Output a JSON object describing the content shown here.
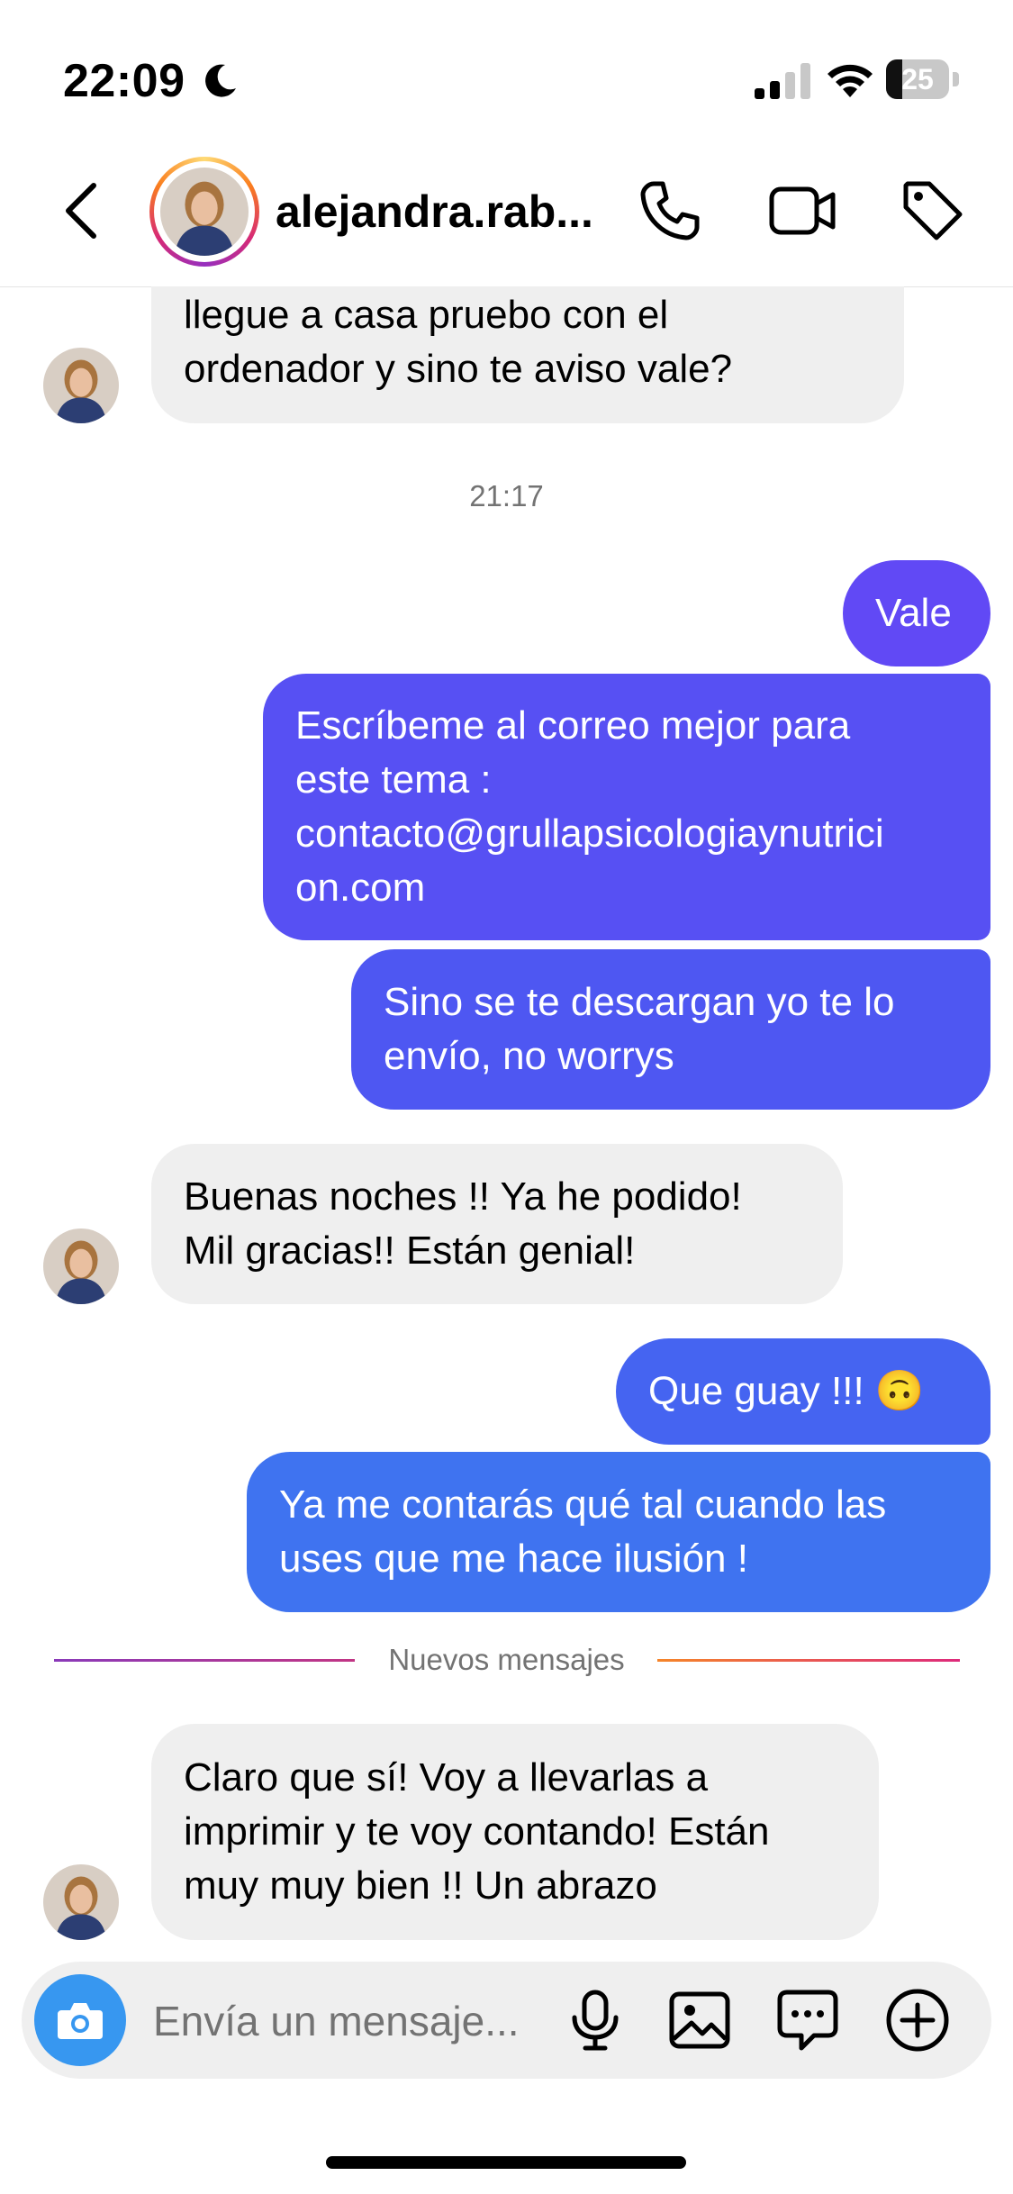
{
  "status_bar": {
    "time": "22:09",
    "battery_percent": "25",
    "battery_level": 0.25
  },
  "header": {
    "username": "alejandra.rab...",
    "icons": [
      "chevron-left-icon",
      "phone-icon",
      "video-camera-icon",
      "tag-icon"
    ]
  },
  "colors": {
    "outgoing_purple": "#6149f5",
    "outgoing_indigo": "#5253f2",
    "outgoing_blue": "#3f73f0",
    "incoming_bg": "#efefef",
    "camera_blue": "#3797f0"
  },
  "messages": [
    {
      "id": "m1",
      "direction": "in",
      "lines": [
        "llegue a casa pruebo con el",
        "ordenador y sino te aviso vale?"
      ]
    },
    {
      "id": "m2",
      "direction": "out",
      "lines": [
        "Vale"
      ]
    },
    {
      "id": "m3",
      "direction": "out",
      "lines": [
        "Escríbeme al correo mejor para",
        "este tema :",
        "contacto@grullapsicologiaynutrici",
        "on.com"
      ]
    },
    {
      "id": "m4",
      "direction": "out",
      "lines": [
        "Sino se te descargan yo te lo",
        "envío, no worrys"
      ]
    },
    {
      "id": "m5",
      "direction": "in",
      "lines": [
        "Buenas noches !! Ya he podido!",
        "Mil gracias!! Están genial!"
      ]
    },
    {
      "id": "m6",
      "direction": "out",
      "lines": [
        "Que guay !!! 🙃"
      ]
    },
    {
      "id": "m7",
      "direction": "out",
      "lines": [
        "Ya me contarás qué tal cuando las",
        "uses que me hace ilusión !"
      ]
    },
    {
      "id": "m8",
      "direction": "in",
      "lines": [
        "Claro que sí! Voy a llevarlas a",
        "imprimir y te voy contando! Están",
        "muy muy bien !! Un abrazo"
      ]
    }
  ],
  "timestamp": "21:17",
  "new_messages_divider": "Nuevos mensajes",
  "composer": {
    "placeholder": "Envía un mensaje...",
    "icons": [
      "camera-icon",
      "microphone-icon",
      "image-icon",
      "sticker-chat-icon",
      "plus-circle-icon"
    ]
  }
}
